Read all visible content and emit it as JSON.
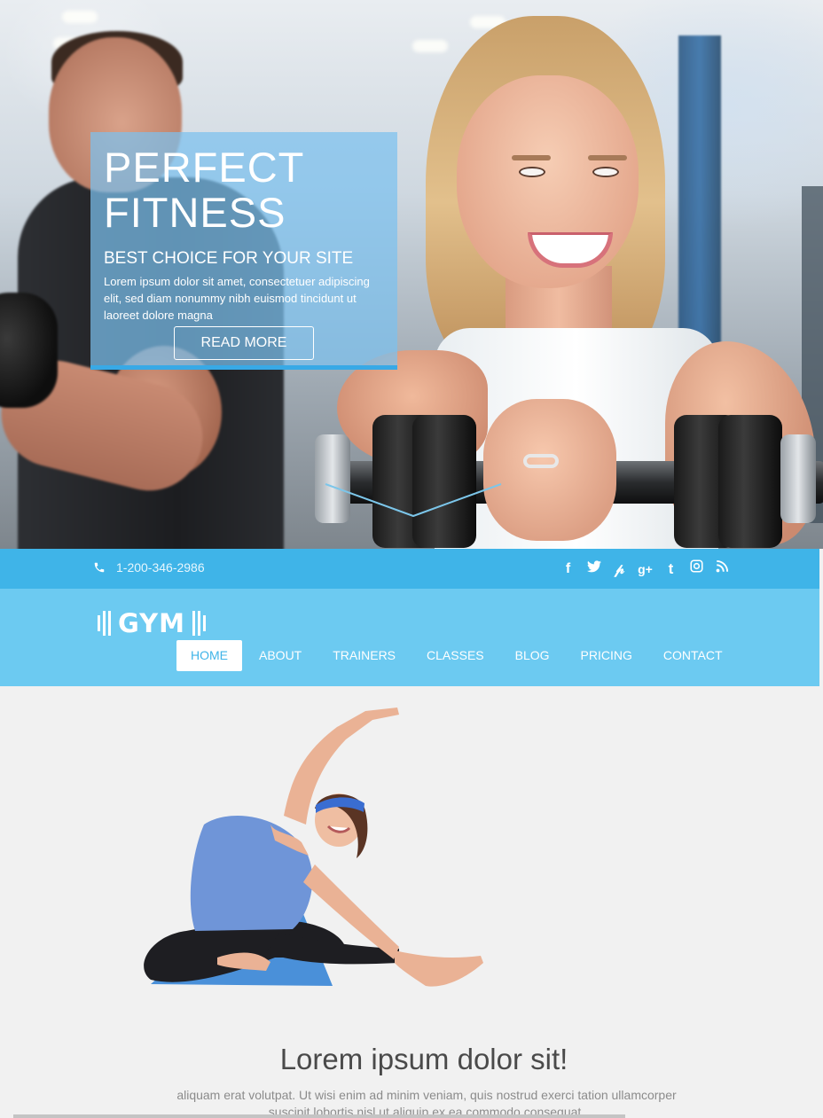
{
  "hero": {
    "title_line1": "PERFECT",
    "title_line2": "FITNESS",
    "subtitle": "BEST CHOICE FOR YOUR SITE",
    "description": "Lorem ipsum dolor sit amet, consectetuer adipiscing elit, sed diam nonummy nibh euismod tincidunt ut laoreet dolore magna",
    "button_label": "READ MORE"
  },
  "topbar": {
    "phone": "1-200-346-2986",
    "socials": [
      {
        "name": "facebook-icon",
        "glyph": "f"
      },
      {
        "name": "twitter-icon",
        "glyph": "t"
      },
      {
        "name": "pinterest-icon",
        "glyph": "p"
      },
      {
        "name": "google-plus-icon",
        "glyph": "g+"
      },
      {
        "name": "tumblr-icon",
        "glyph": "t"
      },
      {
        "name": "instagram-icon",
        "glyph": "◎"
      },
      {
        "name": "rss-icon",
        "glyph": "rss"
      }
    ]
  },
  "brand": {
    "logo_text": "GYM"
  },
  "nav": {
    "items": [
      {
        "label": "HOME",
        "active": true
      },
      {
        "label": "ABOUT",
        "active": false
      },
      {
        "label": "TRAINERS",
        "active": false
      },
      {
        "label": "CLASSES",
        "active": false
      },
      {
        "label": "BLOG",
        "active": false
      },
      {
        "label": "PRICING",
        "active": false
      },
      {
        "label": "CONTACT",
        "active": false
      }
    ]
  },
  "content": {
    "headline": "Lorem ipsum dolor sit!",
    "body": "aliquam erat volutpat. Ut wisi enim ad minim veniam, quis nostrud exerci tation ullamcorper suscipit lobortis nisl ut aliquip ex ea commodo consequat."
  },
  "colors": {
    "accent": "#3fb4e8",
    "nav_bg": "#6ccaf1",
    "promo_bg": "#7cc0ee",
    "page_bg": "#f1f1f1"
  }
}
